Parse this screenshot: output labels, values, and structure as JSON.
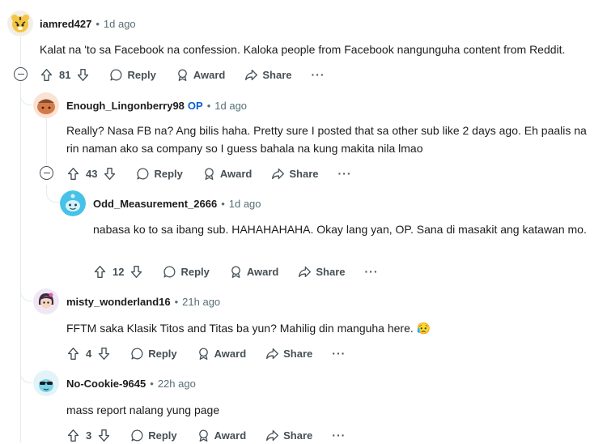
{
  "comments": [
    {
      "author": "iamred427",
      "time": "1d ago",
      "text": "Kalat na 'to sa Facebook na confession. Kaloka people from Facebook nangunguha content from Reddit.",
      "votes": "81",
      "avatar_icon": "tiger-avatar-icon"
    },
    {
      "author": "Enough_Lingonberry98",
      "op": "OP",
      "time": "1d ago",
      "text": "Really? Nasa FB na? Ang bilis haha. Pretty sure I posted that sa other sub like 2 days ago. Eh paalis na rin naman ako sa company so I guess bahala na kung makita nila lmao",
      "votes": "43",
      "avatar_icon": "acorn-avatar-icon"
    },
    {
      "author": "Odd_Measurement_2666",
      "time": "1d ago",
      "text": "nabasa ko to sa ibang sub. HAHAHAHAHA. Okay lang yan, OP. Sana di masakit ang katawan mo.",
      "votes": "12",
      "avatar_icon": "snoo-avatar-icon"
    },
    {
      "author": "misty_wonderland16",
      "time": "21h ago",
      "text": "FFTM saka Klasik Titos and Titas ba yun? Mahilig din manguha here. 😥",
      "votes": "4",
      "avatar_icon": "girl-avatar-icon"
    },
    {
      "author": "No-Cookie-9645",
      "time": "22h ago",
      "text": "mass report nalang yung page",
      "votes": "3",
      "avatar_icon": "sunglasses-avatar-icon"
    }
  ],
  "labels": {
    "separator": "•",
    "reply": "Reply",
    "award": "Award",
    "share": "Share",
    "more": "···"
  }
}
